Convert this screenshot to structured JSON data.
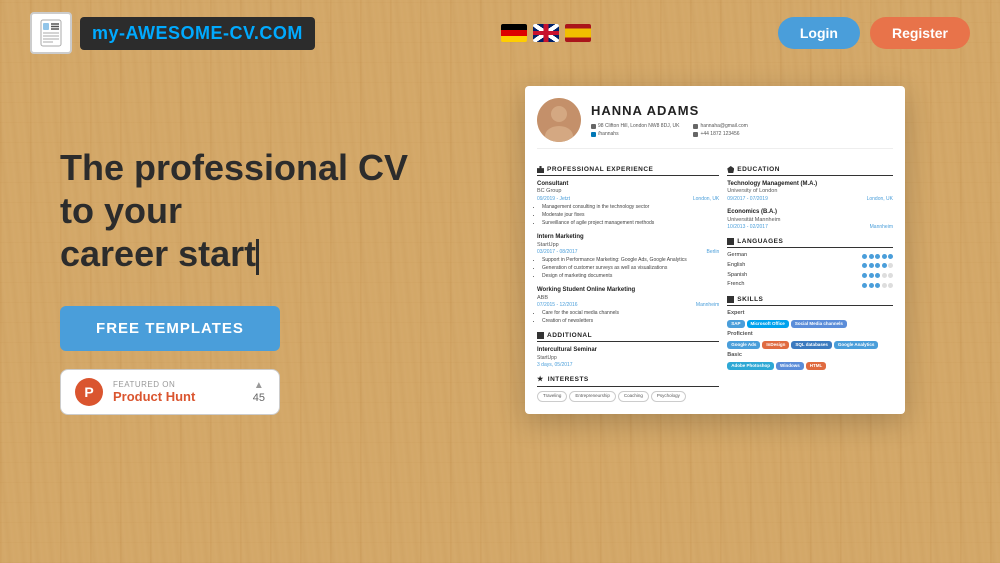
{
  "site": {
    "logo_text": "my-AWESOME-CV.",
    "logo_accent": "COM"
  },
  "nav": {
    "login_label": "Login",
    "register_label": "Register"
  },
  "hero": {
    "headline_line1": "The professional CV to your",
    "headline_line2": "career start",
    "templates_button": "FREE TEMPLATES"
  },
  "product_hunt": {
    "featured_label": "FEATURED ON",
    "name": "Product Hunt",
    "upvote_count": "45"
  },
  "cv": {
    "name": "HANNA ADAMS",
    "address": "98 Clifton Hill, London NW8 8DJ, UK",
    "linkedin": "/hannahs",
    "email": "hannaha@gmail.com",
    "phone": "+44 1872 123456",
    "sections": {
      "experience_title": "PROFESSIONAL EXPERIENCE",
      "education_title": "EDUCATION",
      "languages_title": "LANGUAGES",
      "skills_title": "SKILLS",
      "additional_title": "ADDITIONAL",
      "interests_title": "INTERESTS"
    },
    "jobs": [
      {
        "title": "Consultant",
        "company": "BC Group",
        "dates": "09/2019 - Jetzt",
        "location": "London, UK",
        "bullets": [
          "Management consulting in the technology sector",
          "Moderate jour fixes",
          "Surveillance of agile project management methods"
        ]
      },
      {
        "title": "Intern Marketing",
        "company": "StartUpp",
        "dates": "03/2017 - 08/2017",
        "location": "Berlin",
        "bullets": [
          "Support in Performance Marketing: Google Ads, Google Analytics",
          "Generation of customer surveys as well as visualizations",
          "Design of marketing documents"
        ]
      },
      {
        "title": "Working Student Online Marketing",
        "company": "ABB",
        "dates": "07/2015 - 12/2016",
        "location": "Mannheim",
        "bullets": [
          "Care for the social media channels",
          "Creation of newsletters"
        ]
      }
    ],
    "education": [
      {
        "degree": "Technology Management (M.A.)",
        "school": "University of London",
        "dates": "09/2017 - 07/2019",
        "location": "London, UK"
      },
      {
        "degree": "Economics (B.A.)",
        "school": "Universität Mannheim",
        "dates": "10/2013 - 02/2017",
        "location": "Mannheim"
      }
    ],
    "languages": [
      {
        "name": "German",
        "filled": 5,
        "empty": 0
      },
      {
        "name": "English",
        "filled": 4,
        "empty": 1
      },
      {
        "name": "Spanish",
        "filled": 3,
        "empty": 2
      },
      {
        "name": "French",
        "filled": 3,
        "empty": 2
      }
    ],
    "skills": {
      "expert": [
        "SAP",
        "Microsoft Office",
        "Social Media channels"
      ],
      "proficient": [
        "Google Ads",
        "InDesign",
        "SQL databases",
        "Google Analytics"
      ],
      "basic": [
        "Adobe Photoshop",
        "Windows",
        "HTML"
      ]
    },
    "additional": [
      {
        "title": "Intercultural Seminar",
        "org": "StartUpp",
        "date": "3 days, 05/2017"
      }
    ],
    "interests": [
      "Traveling",
      "Entrepreneurship",
      "Coaching",
      "Psychology"
    ]
  }
}
